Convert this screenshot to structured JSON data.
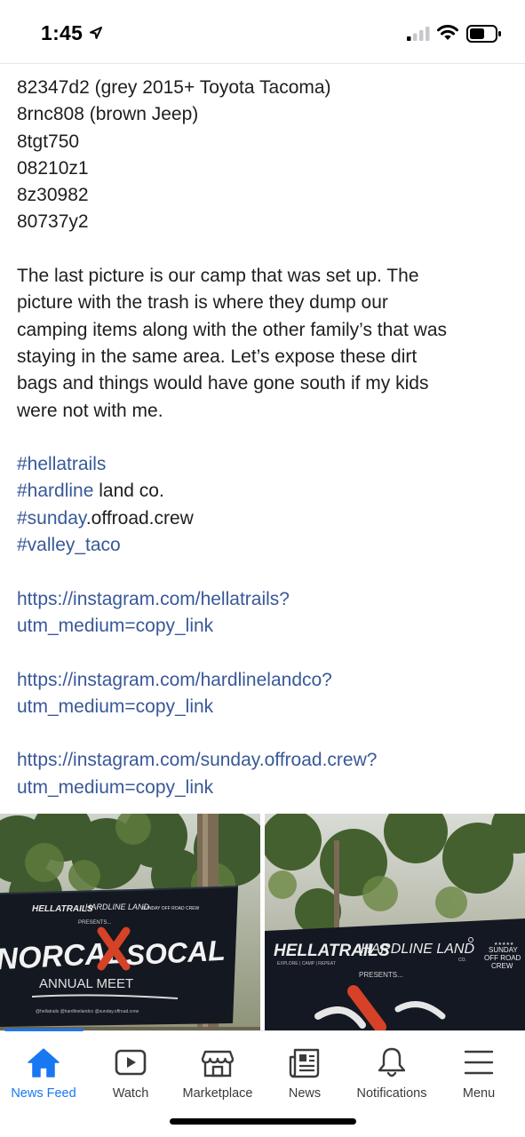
{
  "status": {
    "time": "1:45",
    "icons": [
      "location-arrow-icon",
      "cellular-signal-icon",
      "wifi-icon",
      "battery-icon"
    ]
  },
  "post": {
    "plates": [
      "82347d2 (grey 2015+ Toyota Tacoma)",
      "8rnc808 (brown Jeep)",
      "8tgt750",
      "08210z1",
      "8z30982",
      "80737y2"
    ],
    "body": "The last picture is our camp that was set up. The picture with the trash is where they dump our camping items along with the other family’s that was staying in the same area. Let’s expose these dirt bags and things would have gone south if my kids were not with me.",
    "body_lines": [
      "The last picture is our camp that was set up. The",
      "picture with the trash is where they dump our",
      "camping items along with the other family’s that was",
      "staying in the same area. Let’s expose these dirt",
      "bags and things would have gone south if my kids",
      "were not with me."
    ],
    "hashtags": [
      {
        "tag": "#hellatrails",
        "rest": ""
      },
      {
        "tag": "#hardline",
        "rest": " land co."
      },
      {
        "tag": "#sunday",
        "rest": ".offroad.crew"
      },
      {
        "tag": "#valley_taco",
        "rest": ""
      }
    ],
    "links": [
      {
        "line1": "https://instagram.com/hellatrails?",
        "line2": "utm_medium=copy_link"
      },
      {
        "line1": "https://instagram.com/hardlinelandco?",
        "line2": "utm_medium=copy_link"
      },
      {
        "line1": "https://instagram.com/sunday.offroad.crew?",
        "line2": "utm_medium=copy_link"
      }
    ]
  },
  "photos": {
    "left": {
      "banner_top": [
        "HELLATRAILS",
        "HARDLINE LAND",
        "SUNDAY OFF ROAD CREW"
      ],
      "presents": "PRESENTS...",
      "title_left": "NORCAL",
      "title_right": "SOCAL",
      "subtitle": "ANNUAL MEET",
      "footer": "@hellatrails  @hardlinelandco  @sunday.offroad.crew"
    },
    "right": {
      "brand1": "HELLATRAILS",
      "brand1_sub": "EXPLORE | CAMP | REPEAT",
      "brand2": "HARDLINE LAND",
      "brand2_sub": "CO.",
      "crew": [
        "SUNDAY",
        "OFF ROAD",
        "CREW"
      ],
      "presents": "PRESENTS..."
    }
  },
  "tabbar": {
    "tabs": [
      {
        "label": "News Feed",
        "icon": "home-icon",
        "active": true
      },
      {
        "label": "Watch",
        "icon": "watch-icon",
        "active": false
      },
      {
        "label": "Marketplace",
        "icon": "marketplace-icon",
        "active": false
      },
      {
        "label": "News",
        "icon": "news-icon",
        "active": false
      },
      {
        "label": "Notifications",
        "icon": "bell-icon",
        "active": false
      },
      {
        "label": "Menu",
        "icon": "menu-icon",
        "active": false
      }
    ]
  },
  "colors": {
    "link": "#385898",
    "active": "#1877f2",
    "text": "#1c1e21"
  }
}
